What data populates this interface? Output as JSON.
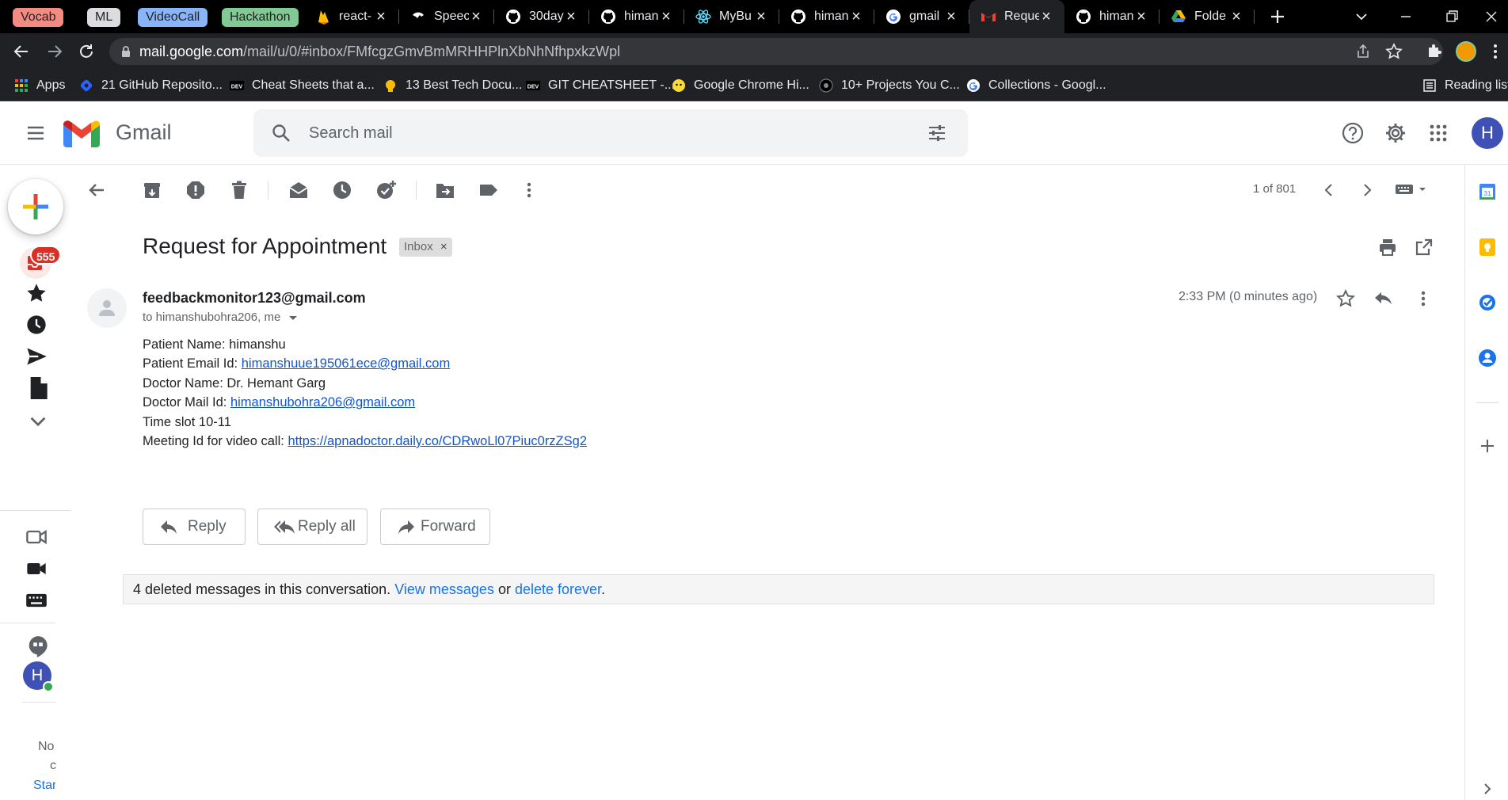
{
  "browser": {
    "tab_groups": [
      {
        "label": "Vocab",
        "color": "#f28b82"
      },
      {
        "label": "ML",
        "color": "#dadce0"
      },
      {
        "label": "VideoCall",
        "color": "#8ab4f8"
      },
      {
        "label": "Hackathon",
        "color": "#81c995"
      }
    ],
    "tabs": [
      {
        "title": "react-",
        "icon": "firebase-icon"
      },
      {
        "title": "Speec",
        "icon": "speech-icon"
      },
      {
        "title": "30day",
        "icon": "github-icon"
      },
      {
        "title": "himan",
        "icon": "github-icon"
      },
      {
        "title": "MyBu",
        "icon": "react-icon"
      },
      {
        "title": "himan",
        "icon": "github-icon"
      },
      {
        "title": "gmail",
        "icon": "google-icon"
      },
      {
        "title": "Reque",
        "icon": "gmail-icon",
        "active": true
      },
      {
        "title": "himan",
        "icon": "github-icon"
      },
      {
        "title": "Folde",
        "icon": "drive-icon"
      }
    ],
    "url_host": "mail.google.com",
    "url_path": "/mail/u/0/#inbox/FMfcgzGmvBmMRHHPlnXbNhNfhpxkzWpl",
    "bookmarks": [
      {
        "label": "Apps",
        "icon": "apps-grid-icon"
      },
      {
        "label": "21 GitHub Reposito...",
        "icon": "hashnode-icon"
      },
      {
        "label": "Cheat Sheets that a...",
        "icon": "dev-icon"
      },
      {
        "label": "13 Best Tech Docu...",
        "icon": "bulb-icon"
      },
      {
        "label": "GIT CHEATSHEET -...",
        "icon": "dev-icon"
      },
      {
        "label": "Google Chrome Hi...",
        "icon": "fox-icon"
      },
      {
        "label": "10+ Projects You C...",
        "icon": "eye-icon"
      },
      {
        "label": "Collections - Googl...",
        "icon": "google-icon"
      }
    ],
    "reading_list": "Reading list"
  },
  "gmail": {
    "logo_text": "Gmail",
    "search_placeholder": "Search mail",
    "account_initial": "H",
    "unread_badge": "555",
    "pagination": "1 of 801",
    "side_labels": [
      "No",
      "c",
      "Star"
    ]
  },
  "email": {
    "subject": "Request for Appointment",
    "label_chip": "Inbox",
    "sender": "feedbackmonitor123@gmail.com",
    "recipients": "to himanshubohra206, me",
    "time": "2:33 PM (0 minutes ago)",
    "body": [
      {
        "prefix": "Patient Name: himanshu",
        "link": ""
      },
      {
        "prefix": "Patient Email Id: ",
        "link": "himanshuue195061ece@gmail.com"
      },
      {
        "prefix": "Doctor Name: Dr. Hemant Garg",
        "link": ""
      },
      {
        "prefix": "Doctor Mail Id: ",
        "link": "himanshubohra206@gmail.com"
      },
      {
        "prefix": "Time slot 10-11",
        "link": ""
      },
      {
        "prefix": "Meeting Id for video call: ",
        "link": "https://apnadoctor.daily.co/CDRwoLl07Piuc0rzZSg2"
      }
    ],
    "reply_label": "Reply",
    "reply_all_label": "Reply all",
    "forward_label": "Forward",
    "deleted_notice": {
      "text": "4 deleted messages in this conversation.",
      "view_link": "View messages",
      "or_text": "or",
      "delete_link": "delete forever",
      "end": "."
    }
  }
}
